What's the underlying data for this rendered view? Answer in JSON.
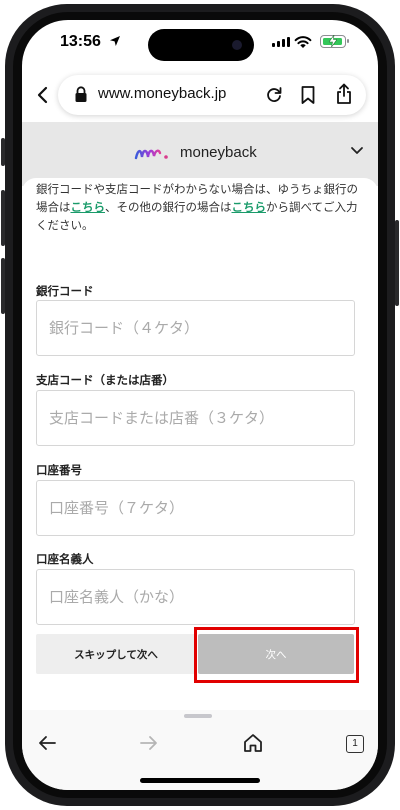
{
  "status": {
    "time": "13:56"
  },
  "browser": {
    "url": "www.moneyback.jp",
    "tab_count": "1"
  },
  "site": {
    "logo_text": "moneyback"
  },
  "intro": {
    "part1": "銀行コードや支店コードがわからない場合は、ゆうちょ銀行の場合は",
    "link1": "こちら",
    "part2": "、その他の銀行の場合は",
    "link2": "こちら",
    "part3": "から調べてご入力ください。"
  },
  "form": {
    "bank_code_label": "銀行コード",
    "bank_code_placeholder": "銀行コード（４ケタ）",
    "branch_code_label": "支店コード（または店番）",
    "branch_code_placeholder": "支店コードまたは店番（３ケタ）",
    "account_number_label": "口座番号",
    "account_number_placeholder": "口座番号（７ケタ）",
    "account_name_label": "口座名義人",
    "account_name_placeholder": "口座名義人（かな）"
  },
  "buttons": {
    "skip_label": "スキップして次へ",
    "next_label": "次へ"
  },
  "colors": {
    "link": "#1a9b6a",
    "highlight": "#e10000",
    "battery": "#34c759",
    "next_disabled": "#bdbdbd"
  }
}
